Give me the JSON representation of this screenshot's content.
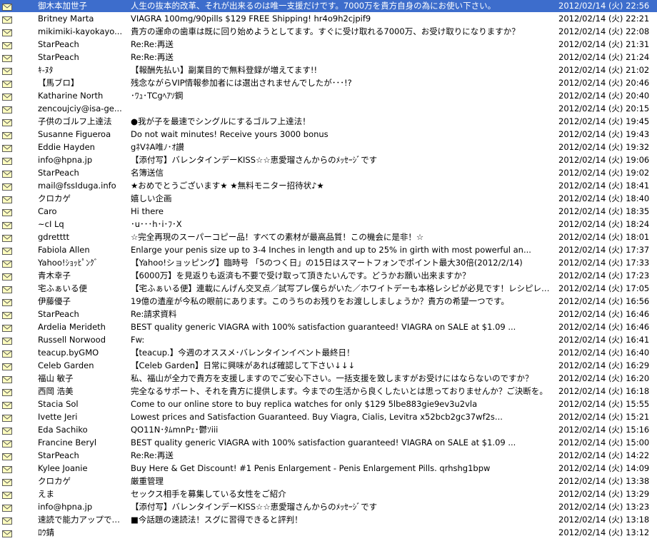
{
  "colors": {
    "selected_bg": "#3d6dcc",
    "envelope_fill": "#ffffbf",
    "envelope_stroke": "#5a5a5a"
  },
  "icon": "envelope-icon",
  "messages": [
    {
      "from": "御木本加世子",
      "subject": "人生の抜本的改革、それが出来るのは唯一支援だけです。7000万を貴方自身の為にお使い下さい。",
      "date": "2012/02/14 (火) 22:56",
      "selected": true
    },
    {
      "from": "Britney Marta",
      "subject": "VIAGRA 100mg/90pills $129 FREE Shipping!            hr4o9h2cjpif9",
      "date": "2012/02/14 (火) 22:21"
    },
    {
      "from": "mikimiki-kayokayo...",
      "subject": "貴方の運命の歯車は既に回り始めようとしてます。すぐに受け取れる7000万、お受け取りになりますか？",
      "date": "2012/02/14 (火) 22:08"
    },
    {
      "from": "StarPeach",
      "subject": "Re:Re:再送",
      "date": "2012/02/14 (火) 21:31"
    },
    {
      "from": "StarPeach",
      "subject": "Re:Re:再送",
      "date": "2012/02/14 (火) 21:24"
    },
    {
      "from": "ｷ-ﾇﾀ",
      "subject": "【報酬先払い】副業目的で無料登録が増えてます!!",
      "date": "2012/02/14 (火) 21:02"
    },
    {
      "from": "【馬ブロ】",
      "subject": "残念ながらVIP情報参加者には選出されませんでしたが･･･!?",
      "date": "2012/02/14 (火) 20:46"
    },
    {
      "from": "Katharine North",
      "subject": "･ﾜｭ･TCgﾍｱｿ鋼",
      "date": "2012/02/14 (火) 20:40"
    },
    {
      "from": "zencoujciy@isa-ge...",
      "subject": "",
      "date": "2012/02/14 (火) 20:15"
    },
    {
      "from": "子供のゴルフ上達法",
      "subject": "●我が子を最速でシングルにするゴルフ上達法！",
      "date": "2012/02/14 (火) 19:45"
    },
    {
      "from": "Susanne Figueroa",
      "subject": "Do not wait minutes! Receive yours 3000 bonus",
      "date": "2012/02/14 (火) 19:43"
    },
    {
      "from": "Eddie Hayden",
      "subject": "gﾈVﾈA唯ﾉ･ｵ讃",
      "date": "2012/02/14 (火) 19:32"
    },
    {
      "from": "info@hpna.jp",
      "subject": "【添付写】バレンタインデーKISS☆☆恵愛瑠さんからのﾒｯｾｰｼﾞです",
      "date": "2012/02/14 (火) 19:06"
    },
    {
      "from": "StarPeach",
      "subject": "名簿送信",
      "date": "2012/02/14 (火) 19:02"
    },
    {
      "from": "mail@fssIduga.info",
      "subject": "★おめでとうございます★ ★無料モニター招待状♪★",
      "date": "2012/02/14 (火) 18:41"
    },
    {
      "from": "クロカゲ",
      "subject": "嬉しい企画",
      "date": "2012/02/14 (火) 18:40"
    },
    {
      "from": "Caro",
      "subject": "Hi there",
      "date": "2012/02/14 (火) 18:35"
    },
    {
      "from": "~cI Lq",
      "subject": "･u･･･h･i･ﾌ･X",
      "date": "2012/02/14 (火) 18:24"
    },
    {
      "from": "gdretttt",
      "subject": "☆完全再現のスーパーコピー品！すべての素材が最高品質！この機会に是非！☆",
      "date": "2012/02/14 (火) 18:01"
    },
    {
      "from": "Fabiola Allen",
      "subject": "Enlarge your penis size up to 3-4 Inches in length and up to 25% in girth with most powerful an...",
      "date": "2012/02/14 (火) 17:37"
    },
    {
      "from": "Yahoo!ｼｮｯﾋﾟﾝｸﾞ",
      "subject": "【Yahoo!ショッピング】臨時号 「5のつく日」の15日はスマートフォンでポイント最大30倍(2012/2/14)",
      "date": "2012/02/14 (火) 17:33"
    },
    {
      "from": "青木幸子",
      "subject": "【6000万】を見返りも返済も不要で受け取って頂きたいんです。どうかお願い出来ますか？",
      "date": "2012/02/14 (火) 17:23"
    },
    {
      "from": "宅ふぁいる便",
      "subject": "【宅ふぁいる便】連載にんげん交叉点／試写プレ僕らがいた／ホワイトデーも本格レシピが必見です！レシピレンタル",
      "date": "2012/02/14 (火) 17:05"
    },
    {
      "from": "伊藤優子",
      "subject": "19億の遺産が今私の眼前にあります。このうちのお残りをお渡ししましょうか？貴方の希望一つです。",
      "date": "2012/02/14 (火) 16:56"
    },
    {
      "from": "StarPeach",
      "subject": "Re:請求資料",
      "date": "2012/02/14 (火) 16:46"
    },
    {
      "from": "Ardelia Merideth",
      "subject": "BEST quality generic VIAGRA with 100% satisfaction guaranteed! VIAGRA on SALE at $1.09       ...",
      "date": "2012/02/14 (火) 16:46"
    },
    {
      "from": "Russell Norwood",
      "subject": "Fw:",
      "date": "2012/02/14 (火) 16:41"
    },
    {
      "from": "teacup.byGMO",
      "subject": "【teacup.】今週のオススメ･バレンタインイベント最終日！",
      "date": "2012/02/14 (火) 16:40"
    },
    {
      "from": "Celeb Garden",
      "subject": "【Celeb Garden】日常に興味があれば確認して下さい↓↓↓",
      "date": "2012/02/14 (火) 16:29"
    },
    {
      "from": "福山 敏子",
      "subject": "私、福山が全力で貴方を支援しますのでご安心下さい。一括支援を致しますがお受けにはならないのですか？",
      "date": "2012/02/14 (火) 16:20"
    },
    {
      "from": "西岡 浩美",
      "subject": "完全なるサポート、それを貴方に提供します。今までの生活から良くしたいとは思っておりませんか？ご決断を。",
      "date": "2012/02/14 (火) 16:18"
    },
    {
      "from": "Stacia Sol",
      "subject": "Come to our online store to buy replica watches for only $129           5lbe883gie9ev3u2vla",
      "date": "2012/02/14 (火) 15:55"
    },
    {
      "from": "Ivette Jeri",
      "subject": "Lowest prices and Satisfaction Guaranteed. Buy Viagra, Cialis, Levitra           x52bcb2gc37wf2s...",
      "date": "2012/02/14 (火) 15:21"
    },
    {
      "from": "Eda Sachiko",
      "subject": "QO11N･ﾀﾑmnPｪ･鬱ｿiii",
      "date": "2012/02/14 (火) 15:16"
    },
    {
      "from": "Francine Beryl",
      "subject": "BEST quality generic VIAGRA with 100% satisfaction guaranteed! VIAGRA on SALE at $1.09       ...",
      "date": "2012/02/14 (火) 15:00"
    },
    {
      "from": "StarPeach",
      "subject": "Re:Re:再送",
      "date": "2012/02/14 (火) 14:22"
    },
    {
      "from": "Kylee Joanie",
      "subject": "Buy Here & Get Discount! #1 Penis Enlargement - Penis Enlargement Pills.           qrhshg1bpw",
      "date": "2012/02/14 (火) 14:09"
    },
    {
      "from": "クロカゲ",
      "subject": "厳重管理",
      "date": "2012/02/14 (火) 13:38"
    },
    {
      "from": "えま",
      "subject": "セックス相手を募集している女性をご紹介",
      "date": "2012/02/14 (火) 13:29"
    },
    {
      "from": "info@hpna.jp",
      "subject": "【添付写】バレンタインデーKISS☆☆恵愛瑠さんからのﾒｯｾｰｼﾞです",
      "date": "2012/02/14 (火) 13:23"
    },
    {
      "from": "速読で能力アップでき...",
      "subject": "■今話題の速読法！スグに習得できると評判！",
      "date": "2012/02/14 (火) 13:18"
    },
    {
      "from": "ﾛｳ錆",
      "subject": "",
      "date": "2012/02/14 (火) 13:12"
    }
  ]
}
